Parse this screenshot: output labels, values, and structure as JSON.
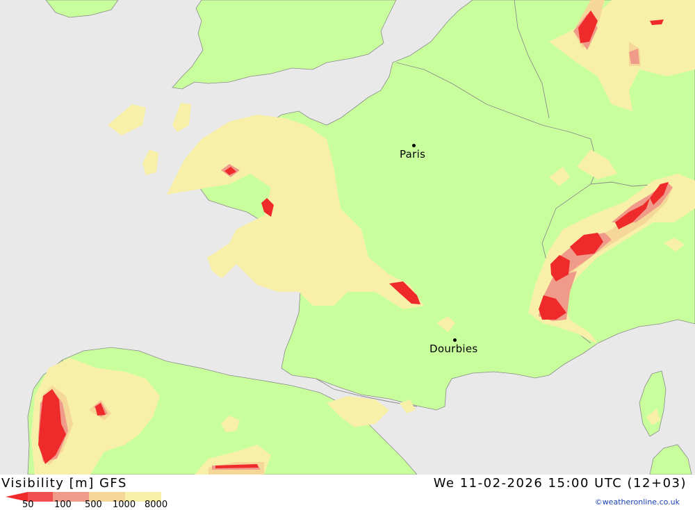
{
  "map": {
    "cities": [
      {
        "name": "Paris"
      },
      {
        "name": "Dourbies"
      }
    ],
    "colors": {
      "sea": "#e9e9e9",
      "land_clear": "#c8ff9c",
      "vis_8000": "#f8f0a8",
      "vis_1000": "#f6d79a",
      "vis_500": "#f09a8a",
      "vis_100": "#f05050",
      "vis_50": "#ee2a2a",
      "border": "#8a8a8a"
    }
  },
  "footer": {
    "title": "Visibility [m] GFS",
    "datetime": "We 11-02-2026 15:00 UTC (12+03)",
    "credit": "©weatheronline.co.uk",
    "legend": [
      {
        "label": "50",
        "color": "#ee2a2a"
      },
      {
        "label": "100",
        "color": "#f05050"
      },
      {
        "label": "500",
        "color": "#f09a8a"
      },
      {
        "label": "1000",
        "color": "#f6d79a"
      },
      {
        "label": "8000",
        "color": "#f8f0a8"
      }
    ]
  }
}
